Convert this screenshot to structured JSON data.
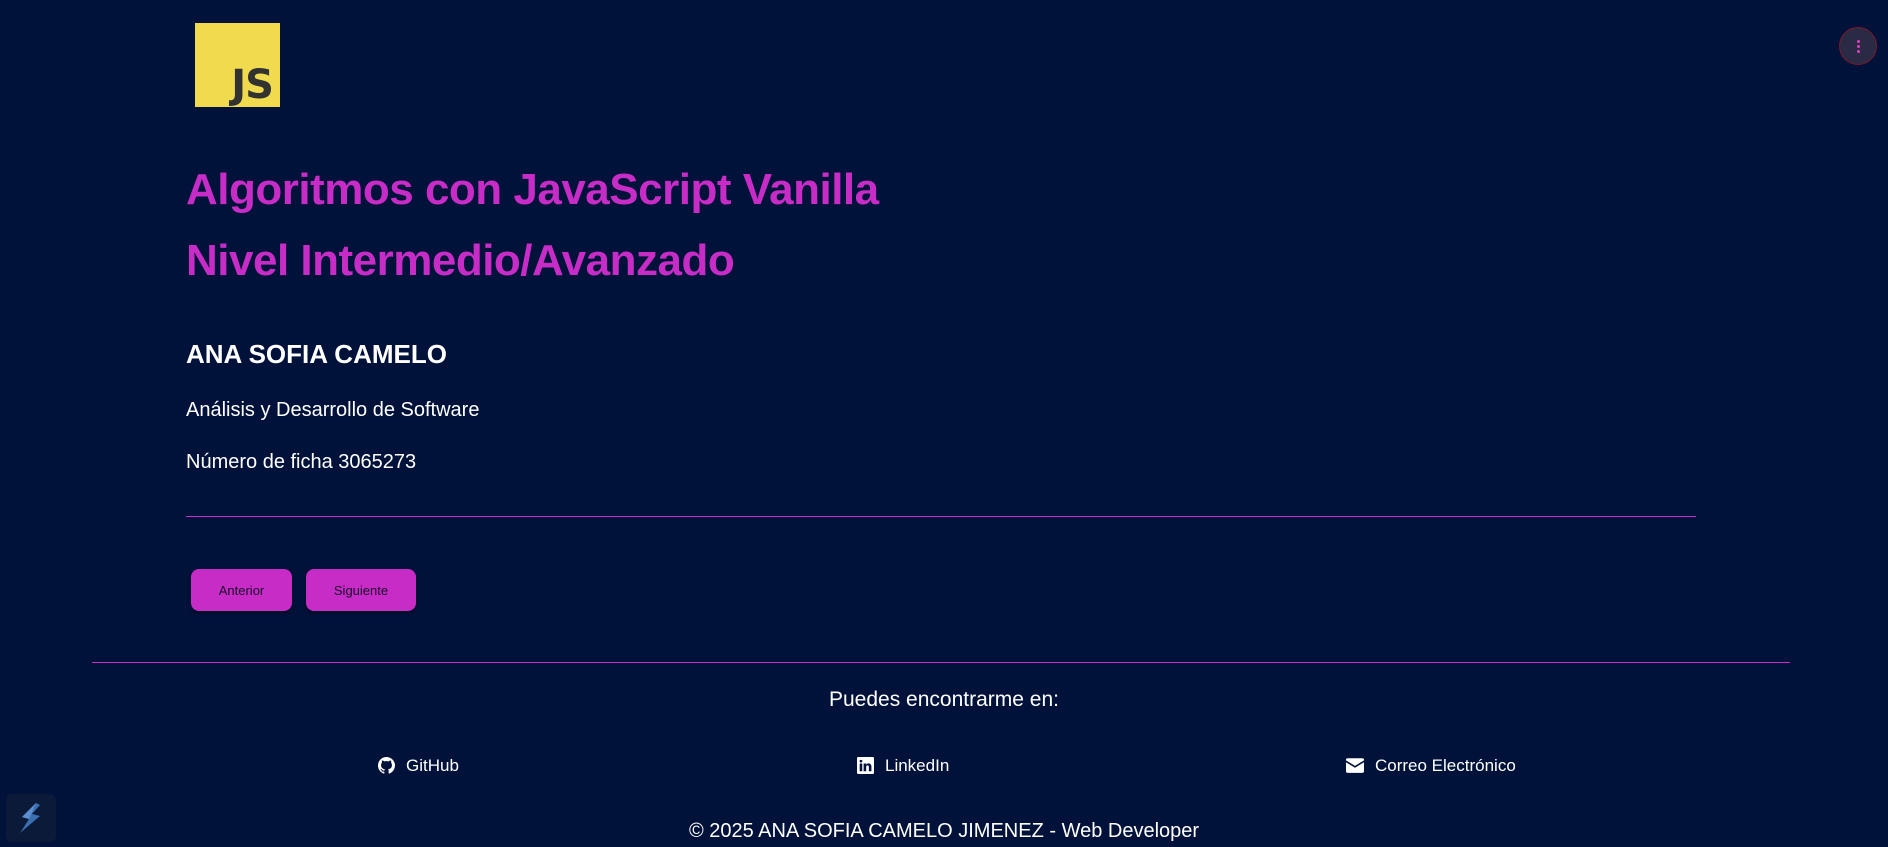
{
  "logo": {
    "text": "JS",
    "background": "#f0db4f",
    "foreground": "#323330"
  },
  "header": {
    "title_line1": "Algoritmos con JavaScript Vanilla",
    "title_line2": "Nivel Intermedio/Avanzado"
  },
  "profile": {
    "name": "ANA SOFIA CAMELO",
    "program": "Análisis y Desarrollo de Software",
    "ficha": "Número de ficha 3065273"
  },
  "navigation": {
    "prev_label": "Anterior",
    "next_label": "Siguiente"
  },
  "footer": {
    "heading": "Puedes encontrarme en:",
    "links": [
      {
        "label": "GitHub",
        "icon": "github-icon"
      },
      {
        "label": "LinkedIn",
        "icon": "linkedin-icon"
      },
      {
        "label": "Correo Electrónico",
        "icon": "envelope-icon"
      }
    ],
    "copyright": "© 2025 ANA SOFIA CAMELO JIMENEZ - Web Developer"
  },
  "overlay": {
    "menu_icon": "vertical-dots-icon",
    "corner_icon": "lightning-icon"
  },
  "colors": {
    "background": "#00113a",
    "accent": "#c72cc7",
    "text": "#ffffff"
  }
}
